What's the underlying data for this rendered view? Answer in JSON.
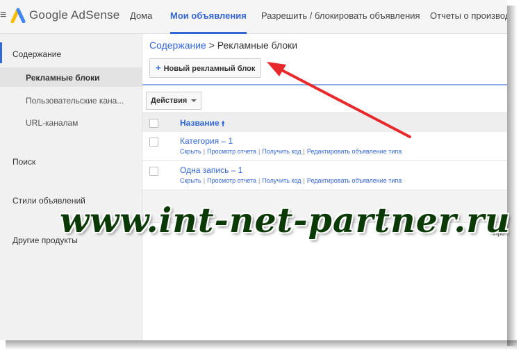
{
  "app": {
    "logo_text": "Google AdSense"
  },
  "nav": [
    {
      "label": "Дома"
    },
    {
      "label": "Мои объявления"
    },
    {
      "label": "Разрешить / блокировать объявления"
    },
    {
      "label": "Отчеты о производ"
    }
  ],
  "sidebar": {
    "section_title": "Содержание",
    "items": [
      {
        "label": "Рекламные блоки"
      },
      {
        "label": "Пользовательские кана..."
      },
      {
        "label": "URL-каналам"
      }
    ],
    "sections": [
      {
        "label": "Поиск"
      },
      {
        "label": "Стили объявлений"
      },
      {
        "label": "Другие продукты"
      }
    ]
  },
  "main": {
    "breadcrumb_link": "Содержание",
    "breadcrumb_sep": ">",
    "breadcrumb_current": "Рекламные блоки",
    "new_button_label": "Новый рекламный блок",
    "actions_label": "Действия",
    "table": {
      "header_name": "Название",
      "rows": [
        {
          "name": "Категория – 1",
          "links": [
            "Скрыть",
            "Просмотр отчета",
            "Получить код",
            "Редактировать объявление типа"
          ]
        },
        {
          "name": "Одна запись – 1",
          "links": [
            "Скрыть",
            "Просмотр отчета",
            "Получить код",
            "Редактировать объявление типа"
          ]
        }
      ]
    },
    "right_note": "Про"
  },
  "watermark": "www.int-net-partner.ru",
  "colors": {
    "accent": "#3367d6",
    "arrow": "#e8292b",
    "watermark": "#0b3a06"
  },
  "icons": {
    "menu": "hamburger-icon",
    "logo": "adsense-logo-icon",
    "plus": "plus-icon",
    "sort": "sort-up-icon"
  }
}
